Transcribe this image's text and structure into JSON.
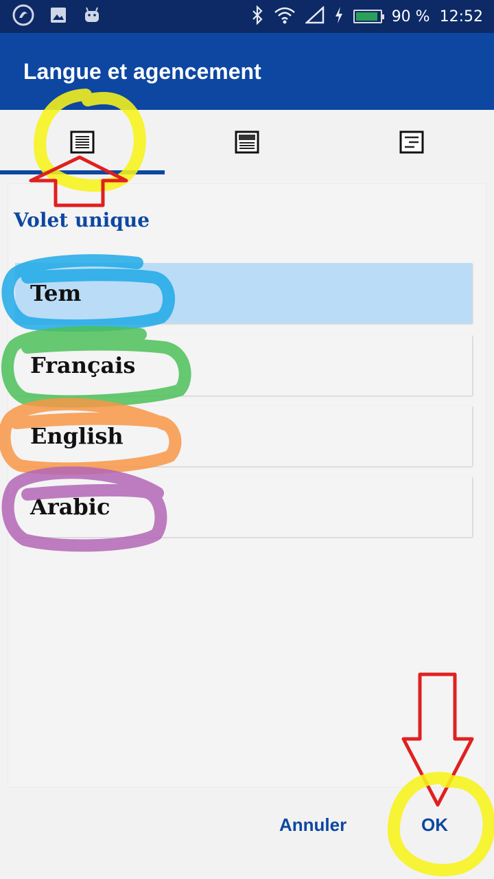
{
  "status_bar": {
    "battery_percent": "90 %",
    "battery_level": 0.9,
    "time": "12:52",
    "icons": [
      "app-logo-icon",
      "image-icon",
      "android-icon",
      "bluetooth-icon",
      "wifi-icon",
      "signal-icon",
      "charging-icon",
      "battery-icon"
    ]
  },
  "app_bar": {
    "title": "Langue et agencement"
  },
  "tabs": {
    "items": [
      {
        "icon": "single-pane-layout-icon",
        "selected": true
      },
      {
        "icon": "double-pane-layout-icon",
        "selected": false
      },
      {
        "icon": "split-layout-icon",
        "selected": false
      }
    ]
  },
  "panel": {
    "title": "Volet unique",
    "languages": [
      {
        "label": "Tem",
        "selected": true
      },
      {
        "label": "Français",
        "selected": false
      },
      {
        "label": "English",
        "selected": false
      },
      {
        "label": "Arabic",
        "selected": false
      }
    ]
  },
  "dialog": {
    "cancel_label": "Annuler",
    "ok_label": "OK"
  },
  "colors": {
    "primary": "#0d47a1",
    "status_bar": "#0d2a66",
    "selected_item": "#bbdcf6",
    "annotation_yellow": "#f7f21a",
    "annotation_blue": "#1fa9e6",
    "annotation_green": "#4cbf58",
    "annotation_orange": "#f79646",
    "annotation_purple": "#b366b5",
    "annotation_red": "#e02020"
  }
}
